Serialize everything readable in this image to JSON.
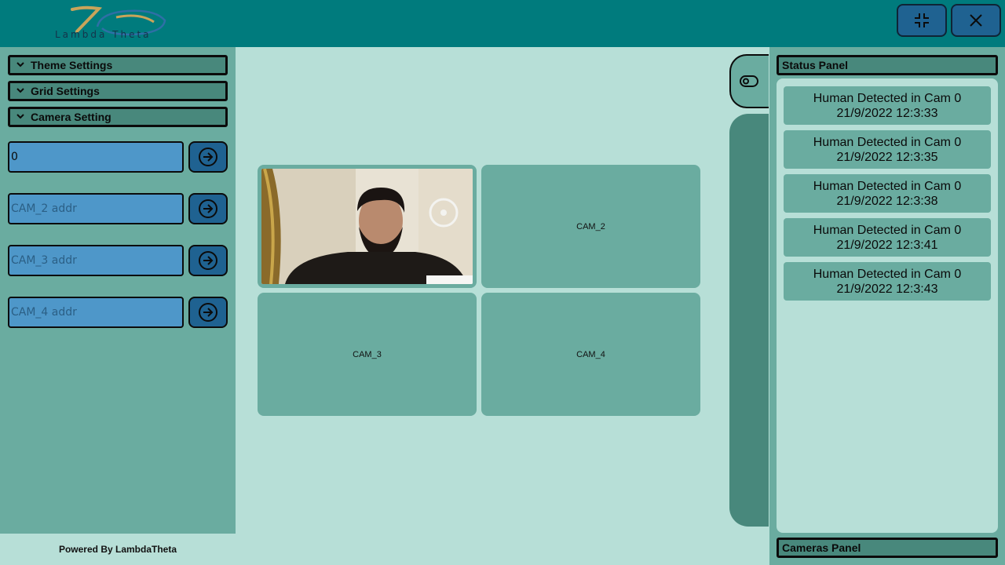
{
  "logo": {
    "text": "Lambda Theta"
  },
  "window_controls": {
    "minimize_icon": "collapse-icon",
    "close_icon": "close-icon"
  },
  "left_panel": {
    "sections": [
      {
        "label": "Theme Settings"
      },
      {
        "label": "Grid Settings"
      },
      {
        "label": "Camera Setting"
      }
    ],
    "cameras": [
      {
        "value": "0",
        "placeholder": ""
      },
      {
        "value": "",
        "placeholder": "CAM_2 addr"
      },
      {
        "value": "",
        "placeholder": "CAM_3 addr"
      },
      {
        "value": "",
        "placeholder": "CAM_4 addr"
      }
    ],
    "footer": "Powered By LambdaTheta"
  },
  "grid": {
    "tiles": [
      {
        "label": ""
      },
      {
        "label": "CAM_2"
      },
      {
        "label": "CAM_3"
      },
      {
        "label": "CAM_4"
      }
    ]
  },
  "right_panel": {
    "status_title": "Status Panel",
    "cameras_title": "Cameras Panel",
    "events": [
      {
        "message": "Human Detected in Cam 0",
        "time": "21/9/2022 12:3:33"
      },
      {
        "message": "Human Detected in Cam 0",
        "time": "21/9/2022 12:3:35"
      },
      {
        "message": "Human Detected in Cam 0",
        "time": "21/9/2022 12:3:38"
      },
      {
        "message": "Human Detected in Cam 0",
        "time": "21/9/2022 12:3:41"
      },
      {
        "message": "Human Detected in Cam 0",
        "time": "21/9/2022 12:3:43"
      }
    ]
  },
  "colors": {
    "topbar": "#007b7d",
    "panel": "#6aaca0",
    "header": "#48887c",
    "background": "#b7dfd7",
    "button": "#1f6291",
    "input": "#4e97c9"
  }
}
